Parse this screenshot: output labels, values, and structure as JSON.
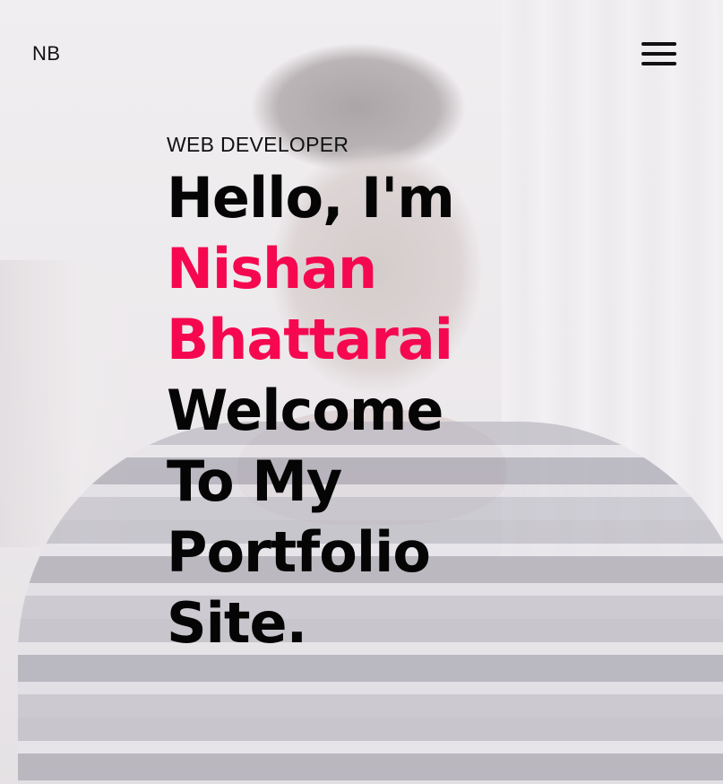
{
  "header": {
    "logo": "NB"
  },
  "hero": {
    "role": "WEB DEVELOPER",
    "lines": [
      {
        "text": "Hello, I'm",
        "highlight": false
      },
      {
        "text": "Nishan",
        "highlight": true
      },
      {
        "text": "Bhattarai",
        "highlight": true
      },
      {
        "text": "Welcome",
        "highlight": false
      },
      {
        "text": "To My",
        "highlight": false
      },
      {
        "text": "Portfolio",
        "highlight": false
      },
      {
        "text": "Site.",
        "highlight": false
      }
    ]
  },
  "colors": {
    "accent": "#f5084f",
    "text": "#050505"
  },
  "icons": {
    "menu": "hamburger-menu-icon"
  }
}
